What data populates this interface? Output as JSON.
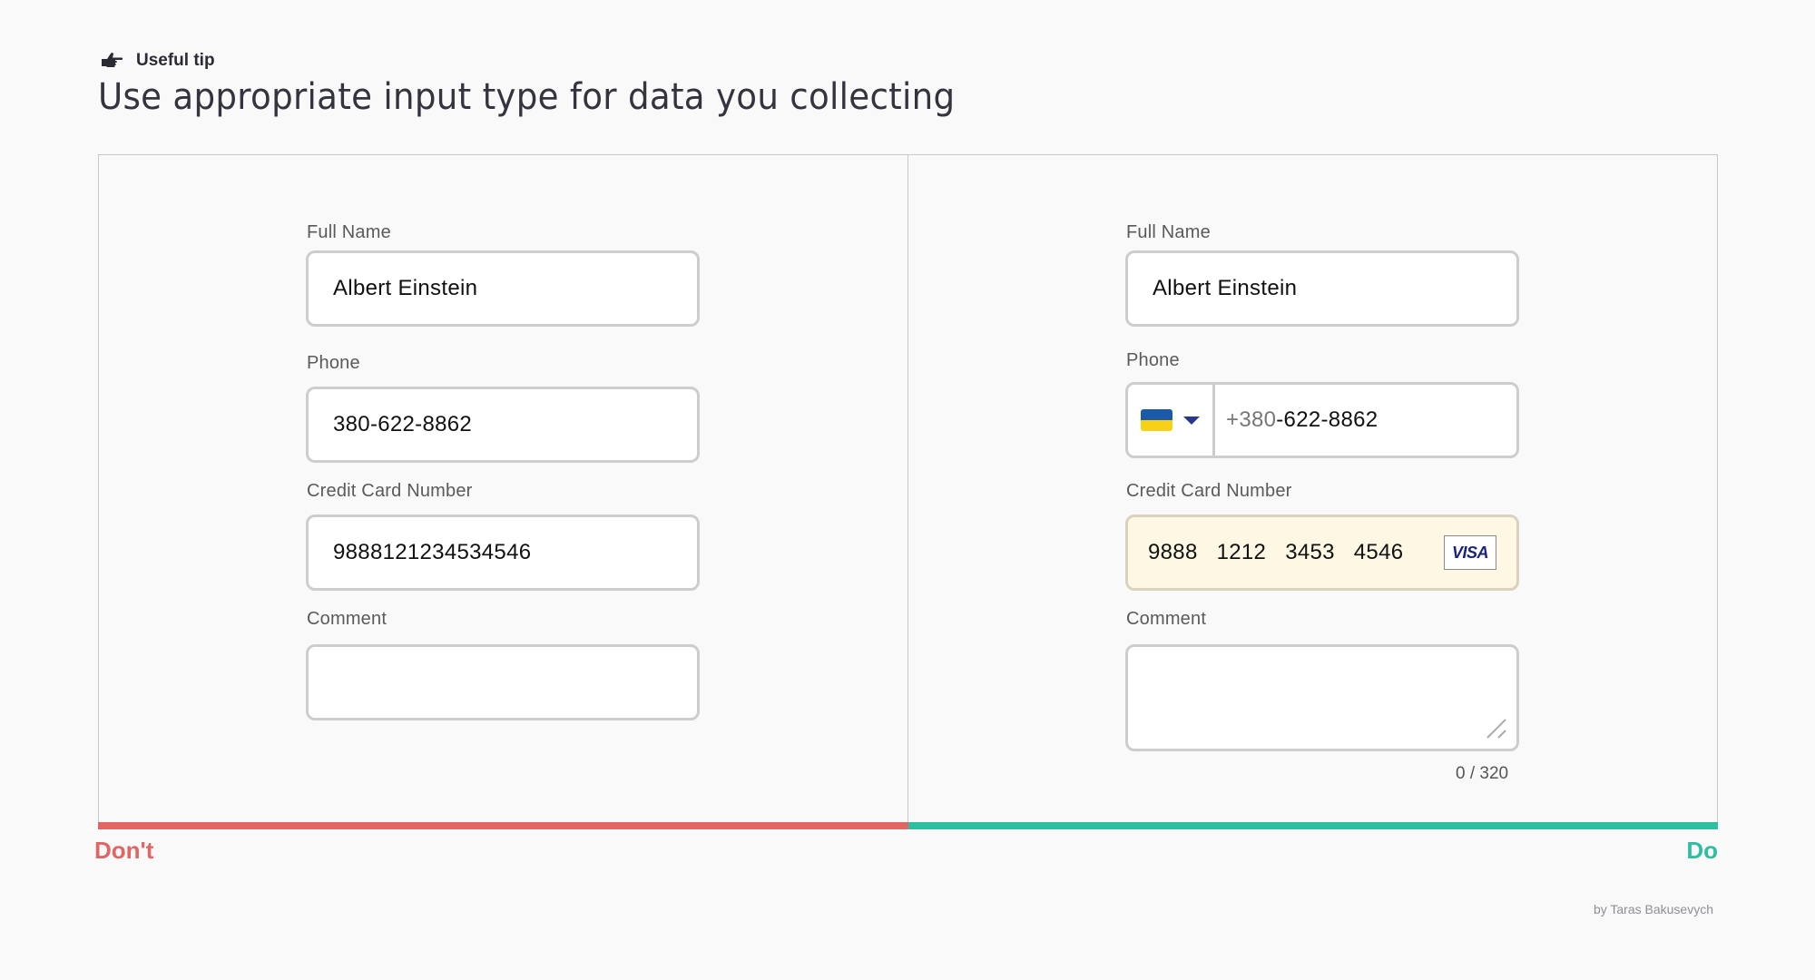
{
  "header": {
    "tip_icon": "pointing-hand-icon",
    "tip_label": "Useful tip",
    "title": "Use appropriate input type for data you collecting"
  },
  "dont_panel": {
    "verdict": "Don't",
    "accent_color": "#e06663",
    "fields": {
      "full_name": {
        "label": "Full Name",
        "value": "Albert Einstein"
      },
      "phone": {
        "label": "Phone",
        "value": "380-622-8862"
      },
      "credit_card": {
        "label": "Credit Card Number",
        "value": "9888121234534546"
      },
      "comment": {
        "label": "Comment",
        "value": ""
      }
    }
  },
  "do_panel": {
    "verdict": "Do",
    "accent_color": "#2ebfa0",
    "fields": {
      "full_name": {
        "label": "Full Name",
        "value": "Albert Einstein"
      },
      "phone": {
        "label": "Phone",
        "country_icon": "ukraine-flag-icon",
        "prefix": "+380",
        "value": "-622-8862"
      },
      "credit_card": {
        "label": "Credit Card Number",
        "groups": [
          "9888",
          "1212",
          "3453",
          "4546"
        ],
        "brand": "VISA",
        "highlight_color": "#fdf7e3"
      },
      "comment": {
        "label": "Comment",
        "value": "",
        "counter": "0 / 320"
      }
    }
  },
  "footer": {
    "credit": "by Taras Bakusevych"
  }
}
